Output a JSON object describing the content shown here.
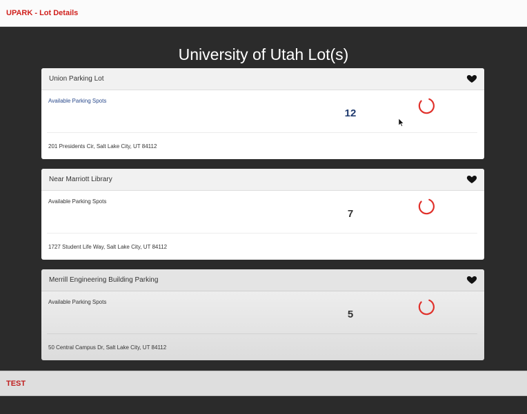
{
  "header": {
    "title": "UPARK - Lot Details"
  },
  "page": {
    "heading": "University of Utah Lot(s)"
  },
  "lots": [
    {
      "name": "Union Parking Lot",
      "available_label": "Available Parking Spots",
      "count": "12",
      "address": "201 Presidents Cir, Salt Lake City, UT 84112"
    },
    {
      "name": "Near Marriott Library",
      "available_label": "Available Parking Spots",
      "count": "7",
      "address": "1727 Student Life Way, Salt Lake City, UT 84112"
    },
    {
      "name": "Merrill Engineering Building Parking",
      "available_label": "Available Parking Spots",
      "count": "5",
      "address": "50 Central Campus Dr, Salt Lake City, UT 84112"
    }
  ],
  "footer": {
    "label": "TEST"
  },
  "colors": {
    "brand_red": "#d0201c",
    "spinner_red": "#e0302a",
    "background": "#2b2b2b"
  },
  "icons": {
    "favorite": "heart-icon",
    "loading": "loading-spinner-icon"
  }
}
